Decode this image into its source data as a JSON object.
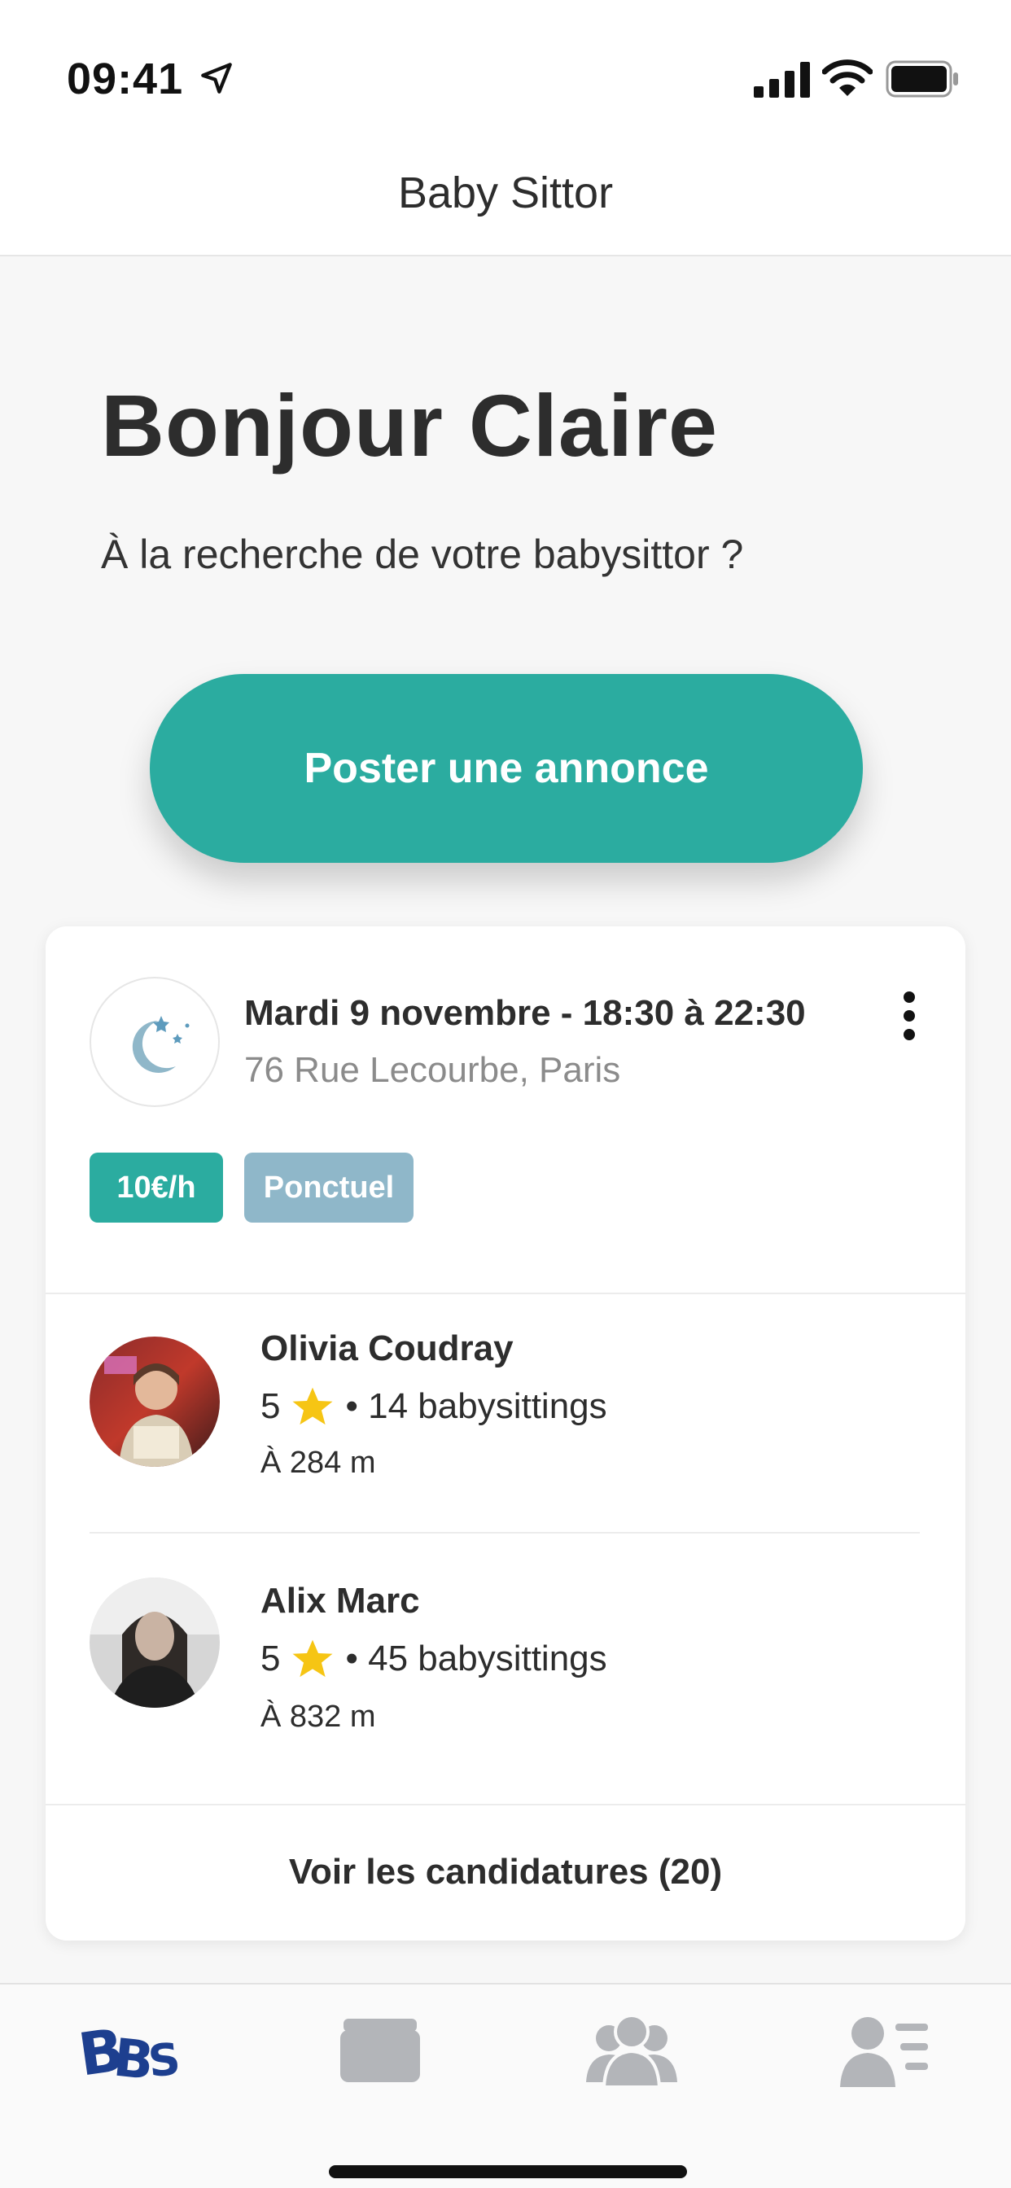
{
  "status_bar": {
    "time": "09:41"
  },
  "nav": {
    "title": "Baby Sittor"
  },
  "greeting": {
    "title": "Bonjour Claire",
    "subtitle": "À la recherche de votre babysittor ?"
  },
  "cta": {
    "label": "Poster une annonce"
  },
  "job": {
    "date": "Mardi 9 novembre - 18:30 à 22:30",
    "address": "76 Rue Lecourbe, Paris",
    "rate": "10€/h",
    "type": "Ponctuel",
    "icon": "moon-stars-icon"
  },
  "sitters": [
    {
      "name": "Olivia Coudray",
      "rating": "5",
      "babysittings": "• 14 babysittings",
      "distance": "À 284 m"
    },
    {
      "name": "Alix Marc",
      "rating": "5",
      "babysittings": "• 45 babysittings",
      "distance": "À 832 m"
    }
  ],
  "applications": {
    "label": "Voir les candidatures (20)"
  },
  "tabs": [
    {
      "icon": "bbs-logo-icon",
      "active": true
    },
    {
      "icon": "wallet-icon",
      "active": false
    },
    {
      "icon": "group-icon",
      "active": false
    },
    {
      "icon": "profile-list-icon",
      "active": false
    }
  ],
  "colors": {
    "accent": "#2baca0",
    "badge_secondary": "#8fb7c9",
    "brand_blue": "#1d3f8f",
    "star": "#f6c514",
    "tab_inactive": "#b3b5b9"
  }
}
